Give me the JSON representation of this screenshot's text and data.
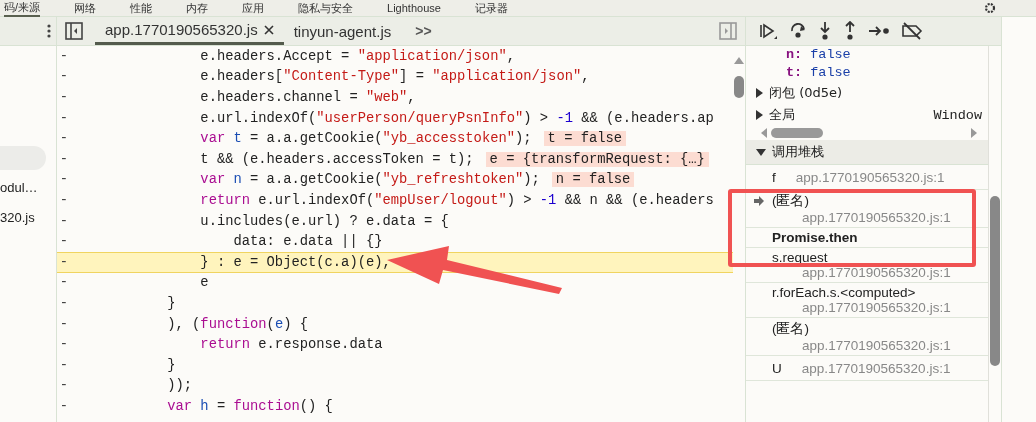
{
  "top_tabs": [
    {
      "label": "码/来源",
      "selected": true
    },
    {
      "label": "网络",
      "selected": false
    },
    {
      "label": "性能",
      "selected": false
    },
    {
      "label": "内存",
      "selected": false
    },
    {
      "label": "应用",
      "selected": false
    },
    {
      "label": "隐私与安全",
      "selected": false
    },
    {
      "label": "Lighthouse",
      "selected": false
    },
    {
      "label": "记录器",
      "selected": false
    }
  ],
  "sidebar": {
    "items": [
      {
        "selected": true
      },
      {
        "label": "odul…",
        "selected": false
      },
      {
        "label": "320.js",
        "selected": false
      }
    ]
  },
  "file_tabs": [
    {
      "label": "app.1770190565320.js",
      "selected": true,
      "closable": true
    },
    {
      "label": "tinyun-agent.js",
      "selected": false,
      "closable": false
    }
  ],
  "more_tabs": ">>",
  "code": [
    {
      "marker": "-",
      "highlighted": false,
      "tokens": [
        {
          "kind": "plain",
          "t": "            e.headers.Accept = "
        },
        {
          "kind": "string",
          "t": "\"application/json\""
        },
        {
          "kind": "plain",
          "t": ","
        }
      ]
    },
    {
      "marker": "-",
      "highlighted": false,
      "tokens": [
        {
          "kind": "plain",
          "t": "            e.headers["
        },
        {
          "kind": "string",
          "t": "\"Content-Type\""
        },
        {
          "kind": "plain",
          "t": "] = "
        },
        {
          "kind": "string",
          "t": "\"application/json\""
        },
        {
          "kind": "plain",
          "t": ","
        }
      ]
    },
    {
      "marker": "-",
      "highlighted": false,
      "tokens": [
        {
          "kind": "plain",
          "t": "            e.headers.channel = "
        },
        {
          "kind": "string",
          "t": "\"web\""
        },
        {
          "kind": "plain",
          "t": ","
        }
      ]
    },
    {
      "marker": "-",
      "highlighted": false,
      "tokens": [
        {
          "kind": "plain",
          "t": "            e.url.indexOf("
        },
        {
          "kind": "string",
          "t": "\"userPerson/queryPsnInfo\""
        },
        {
          "kind": "plain",
          "t": ") > "
        },
        {
          "kind": "number",
          "t": "-1"
        },
        {
          "kind": "plain",
          "t": " && (e.headers.ap"
        }
      ]
    },
    {
      "marker": "-",
      "highlighted": false,
      "tokens": [
        {
          "kind": "keyword",
          "t": "            var"
        },
        {
          "kind": "definition",
          "t": " t"
        },
        {
          "kind": "plain",
          "t": " = a.a.getCookie("
        },
        {
          "kind": "string",
          "t": "\"yb_accesstoken\""
        },
        {
          "kind": "plain",
          "t": ");"
        }
      ],
      "inline_value": "t = false"
    },
    {
      "marker": "-",
      "highlighted": false,
      "tokens": [
        {
          "kind": "plain",
          "t": "            t && (e.headers.accessToken = t);"
        }
      ],
      "inline_value": "e = {transformRequest: {…}"
    },
    {
      "marker": "-",
      "highlighted": false,
      "tokens": [
        {
          "kind": "keyword",
          "t": "            var"
        },
        {
          "kind": "definition",
          "t": " n"
        },
        {
          "kind": "plain",
          "t": " = a.a.getCookie("
        },
        {
          "kind": "string",
          "t": "\"yb_refreshtoken\""
        },
        {
          "kind": "plain",
          "t": ");"
        }
      ],
      "inline_value": "n = false"
    },
    {
      "marker": "-",
      "highlighted": false,
      "tokens": [
        {
          "kind": "keyword",
          "t": "            return"
        },
        {
          "kind": "plain",
          "t": " e.url.indexOf("
        },
        {
          "kind": "string",
          "t": "\"empUser/logout\""
        },
        {
          "kind": "plain",
          "t": ") > "
        },
        {
          "kind": "number",
          "t": "-1"
        },
        {
          "kind": "plain",
          "t": " && n && (e.headers"
        }
      ]
    },
    {
      "marker": "-",
      "highlighted": false,
      "tokens": [
        {
          "kind": "plain",
          "t": "            u.includes(e.url) ? e.data = {"
        }
      ]
    },
    {
      "marker": "-",
      "highlighted": false,
      "tokens": [
        {
          "kind": "plain",
          "t": "                data: e.data || {}"
        }
      ]
    },
    {
      "marker": "-",
      "highlighted": true,
      "tokens": [
        {
          "kind": "plain",
          "t": "            } : e = Object(c.a)(e),"
        }
      ]
    },
    {
      "marker": "-",
      "highlighted": false,
      "tokens": [
        {
          "kind": "plain",
          "t": "            e"
        }
      ]
    },
    {
      "marker": "-",
      "highlighted": false,
      "tokens": [
        {
          "kind": "plain",
          "t": "        }"
        }
      ]
    },
    {
      "marker": "-",
      "highlighted": false,
      "tokens": [
        {
          "kind": "plain",
          "t": "        ), ("
        },
        {
          "kind": "keyword",
          "t": "function"
        },
        {
          "kind": "plain",
          "t": "("
        },
        {
          "kind": "definition",
          "t": "e"
        },
        {
          "kind": "plain",
          "t": ") {"
        }
      ]
    },
    {
      "marker": "-",
      "highlighted": false,
      "tokens": [
        {
          "kind": "keyword",
          "t": "            return"
        },
        {
          "kind": "plain",
          "t": " e.response.data"
        }
      ]
    },
    {
      "marker": "-",
      "highlighted": false,
      "tokens": [
        {
          "kind": "plain",
          "t": "        }"
        }
      ]
    },
    {
      "marker": "-",
      "highlighted": false,
      "tokens": [
        {
          "kind": "plain",
          "t": "        ));"
        }
      ]
    },
    {
      "marker": "-",
      "highlighted": false,
      "tokens": [
        {
          "kind": "keyword",
          "t": "        var"
        },
        {
          "kind": "definition",
          "t": " h"
        },
        {
          "kind": "plain",
          "t": " = "
        },
        {
          "kind": "keyword",
          "t": "function"
        },
        {
          "kind": "plain",
          "t": "() {"
        }
      ]
    }
  ],
  "scope": [
    {
      "kind": "var",
      "name": "n:",
      "value": "false"
    },
    {
      "kind": "var",
      "name": "t:",
      "value": "false"
    },
    {
      "kind": "group",
      "name": "闭包 (0d5e)",
      "expanded": false
    },
    {
      "kind": "group",
      "name": "全局",
      "value": "Window",
      "expanded": false
    }
  ],
  "call_stack": {
    "title": "调用堆栈",
    "expanded": true,
    "frames": [
      {
        "kind": "inline",
        "name": "f",
        "location": "app.1770190565320.js:1",
        "current": false
      },
      {
        "kind": "stacked",
        "name": "(匿名)",
        "location": "app.1770190565320.js:1",
        "current": true
      },
      {
        "kind": "async",
        "name": "Promise.then"
      },
      {
        "kind": "stacked",
        "name": "s.request",
        "location": "app.1770190565320.js:1",
        "current": false
      },
      {
        "kind": "stacked",
        "name": "r.forEach.s.<computed>",
        "location": "app.1770190565320.js:1",
        "current": false
      },
      {
        "kind": "stacked",
        "name": "(匿名)",
        "location": "app.1770190565320.js:1",
        "current": false
      },
      {
        "kind": "inline",
        "name": "U",
        "location": "app.1770190565320.js:1",
        "current": false
      }
    ]
  }
}
